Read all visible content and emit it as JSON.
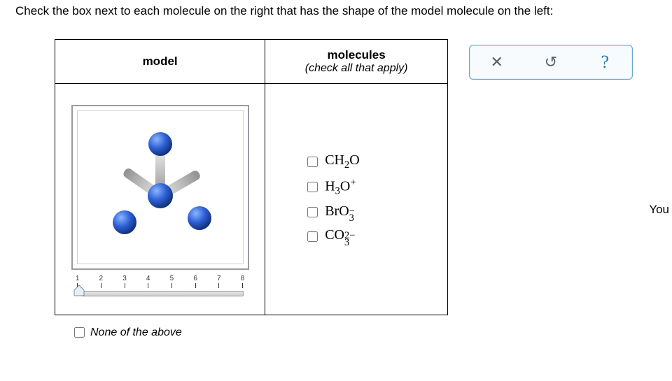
{
  "instruction": "Check the box next to each molecule on the right that has the shape of the model molecule on the left:",
  "headers": {
    "model": "model",
    "molecules": "molecules",
    "molecules_sub": "(check all that apply)"
  },
  "slider": {
    "ticks": [
      "1",
      "2",
      "3",
      "4",
      "5",
      "6",
      "7",
      "8"
    ]
  },
  "molecules": {
    "items": [
      {
        "formula_html": "CH<span class='sub'>2</span>O"
      },
      {
        "formula_html": "H<span class='sub'>3</span>O<span class='sup'>+</span>"
      },
      {
        "formula_html": "BrO<span class='stack'><span>−</span><span>3</span></span>"
      },
      {
        "formula_html": "CO<span class='stack'><span>2−</span><span>3</span></span>"
      }
    ]
  },
  "none_label": "None of the above",
  "toolbar": {
    "close": "✕",
    "reset": "↺",
    "help": "?"
  },
  "side_text": "You"
}
